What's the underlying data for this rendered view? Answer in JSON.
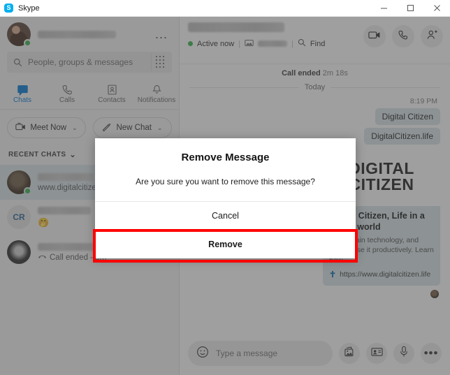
{
  "window": {
    "app_title": "Skype",
    "logo_letter": "S",
    "logo_color": "#00aff0",
    "minimize_label": "Minimize",
    "maximize_label": "Maximize",
    "close_label": "Close"
  },
  "sidebar": {
    "profile": {
      "name_redacted": "",
      "presence": "online",
      "more_label": "..."
    },
    "search": {
      "placeholder": "People, groups & messages",
      "value": "",
      "dialpad_label": "Dial pad"
    },
    "tabs": [
      {
        "label": "Chats",
        "icon": "chat-icon",
        "active": true
      },
      {
        "label": "Calls",
        "icon": "phone-icon",
        "active": false
      },
      {
        "label": "Contacts",
        "icon": "contacts-icon",
        "active": false
      },
      {
        "label": "Notifications",
        "icon": "bell-icon",
        "active": false
      }
    ],
    "actions": [
      {
        "label": "Meet Now",
        "icon": "video-icon",
        "chevron": "⌄"
      },
      {
        "label": "New Chat",
        "icon": "compose-icon",
        "chevron": "⌄"
      }
    ],
    "recent_header": {
      "label": "RECENT CHATS",
      "chevron": "⌄"
    },
    "chats": [
      {
        "name_redacted": "",
        "subtitle": "www.digitalcitizen...",
        "avatar": "photo",
        "presence": "online",
        "selected": true
      },
      {
        "name_redacted": "",
        "subtitle": "🤭",
        "avatar": "initials",
        "initials": "CR",
        "selected": false
      },
      {
        "name_redacted": "",
        "subtitle": "Call ended - 3m",
        "avatar": "photo",
        "icon": "call-ended-icon",
        "selected": false
      }
    ]
  },
  "conversation": {
    "header": {
      "contact_name_redacted": "",
      "status": "Active now",
      "separator": "|",
      "find_label": "Find",
      "find_icon": "search-icon",
      "actions": [
        {
          "name": "video-call-button",
          "icon": "video-camera-icon"
        },
        {
          "name": "audio-call-button",
          "icon": "phone-icon"
        },
        {
          "name": "add-people-button",
          "icon": "add-person-icon"
        }
      ]
    },
    "call_banner": {
      "label": "Call ended",
      "duration": "2m 18s"
    },
    "day_divider": "Today",
    "timestamp": "8:19 PM",
    "messages": [
      {
        "text": "Digital Citizen",
        "outgoing": true
      },
      {
        "text": "DigitalCitizen.life",
        "outgoing": true
      }
    ],
    "link_preview": {
      "banner_line1": "DIGITAL",
      "banner_line2": "CITIZEN",
      "title": "Digital Citizen, Life in a digital world",
      "description": "We explain technology, and how to use it productively. Learn how",
      "url": "https://www.digitalcitizen.life",
      "favicon": "✝"
    },
    "composer": {
      "emoji_icon": "smiley-icon",
      "placeholder": "Type a message",
      "value": "",
      "buttons": [
        {
          "name": "send-image-button",
          "icon": "image-icon"
        },
        {
          "name": "send-contact-button",
          "icon": "contact-card-icon"
        },
        {
          "name": "voice-message-button",
          "icon": "microphone-icon"
        },
        {
          "name": "more-options-button",
          "icon": "ellipsis-icon"
        }
      ]
    }
  },
  "dialog": {
    "title": "Remove Message",
    "message": "Are you sure you want to remove this message?",
    "cancel_label": "Cancel",
    "confirm_label": "Remove",
    "highlight_color": "#ff0000"
  }
}
